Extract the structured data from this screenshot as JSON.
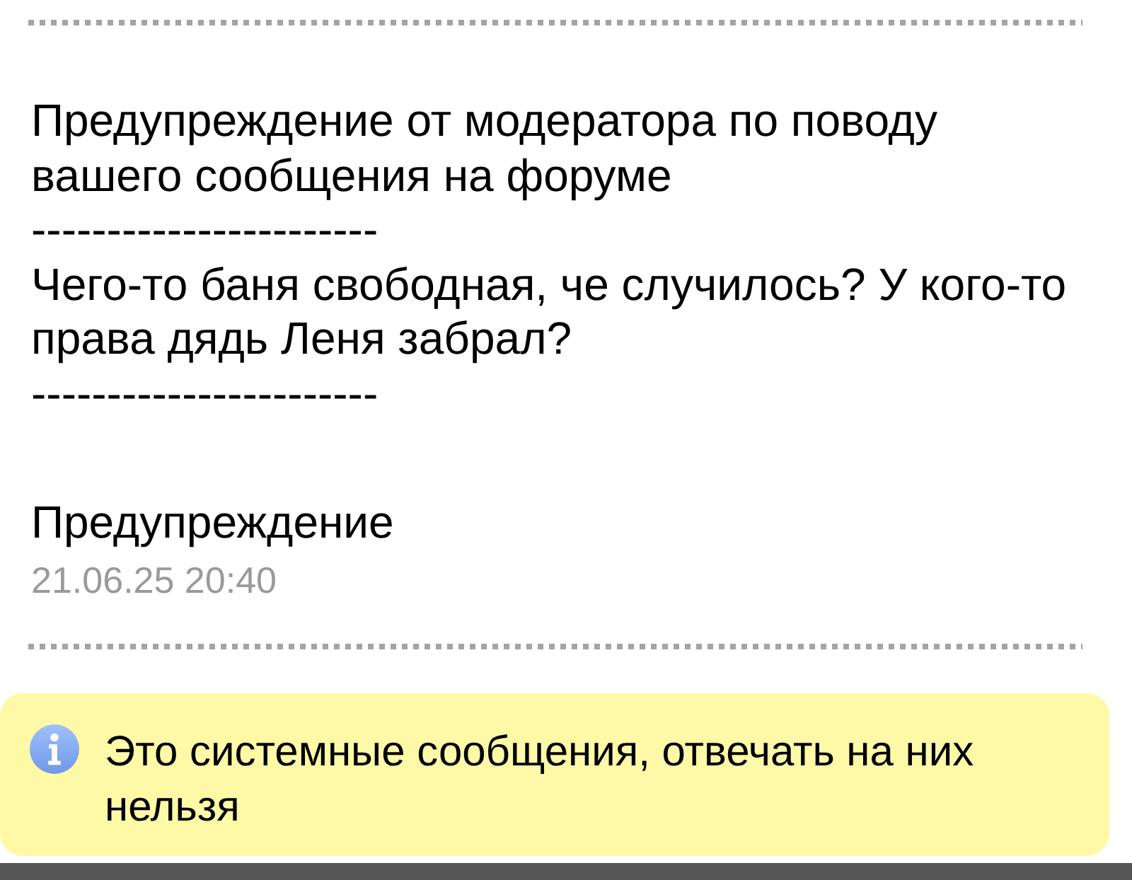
{
  "message": {
    "body": [
      {
        "kind": "text",
        "text": "Предупреждение от модератора по поводу вашего сообщения на форуме"
      },
      {
        "kind": "separator",
        "text": "-----------------------"
      },
      {
        "kind": "text",
        "text": "Чего-то баня свободная, че случилось? У кого-то права дядь Леня забрал?"
      },
      {
        "kind": "separator",
        "text": "-----------------------"
      }
    ],
    "sender": "Предупреждение",
    "date": "21.06.25 20:40"
  },
  "notice": {
    "text": "Это системные сообщения, отвечать на них нельзя"
  }
}
